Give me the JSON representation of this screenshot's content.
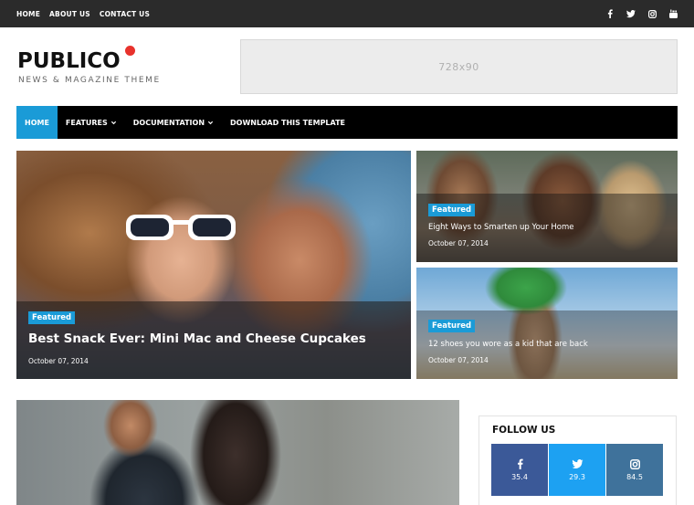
{
  "topbar": {
    "links": [
      "HOME",
      "ABOUT US",
      "CONTACT US"
    ],
    "social_icons": [
      "facebook-icon",
      "twitter-icon",
      "instagram-icon",
      "youtube-icon"
    ]
  },
  "header": {
    "logo": "PUBLICO",
    "tagline": "NEWS & MAGAZINE THEME",
    "ad_label": "728x90"
  },
  "nav": {
    "items": [
      {
        "label": "HOME",
        "active": true,
        "dropdown": false
      },
      {
        "label": "FEATURES",
        "active": false,
        "dropdown": true
      },
      {
        "label": "DOCUMENTATION",
        "active": false,
        "dropdown": true
      },
      {
        "label": "DOWNLOAD THIS TEMPLATE",
        "active": false,
        "dropdown": false
      }
    ]
  },
  "featured": [
    {
      "badge": "Featured",
      "title": "Best Snack Ever: Mini Mac and Cheese Cupcakes",
      "date": "October 07, 2014"
    },
    {
      "badge": "Featured",
      "title": "Eight Ways to Smarten up Your Home",
      "date": "October 07, 2014"
    },
    {
      "badge": "Featured",
      "title": "12 shoes you wore as a kid that are back",
      "date": "October 07, 2014"
    }
  ],
  "follow": {
    "title": "FOLLOW US",
    "items": [
      {
        "network": "facebook",
        "icon": "facebook-icon",
        "count": "35.4",
        "color": "#3b5998"
      },
      {
        "network": "twitter",
        "icon": "twitter-icon",
        "count": "29.3",
        "color": "#1da1f2"
      },
      {
        "network": "instagram",
        "icon": "instagram-icon",
        "count": "84.5",
        "color": "#3f729b"
      }
    ]
  },
  "colors": {
    "accent": "#1a9bd7",
    "logo_dot": "#e8322c",
    "topbar": "#2b2b2b",
    "nav": "#000000"
  }
}
